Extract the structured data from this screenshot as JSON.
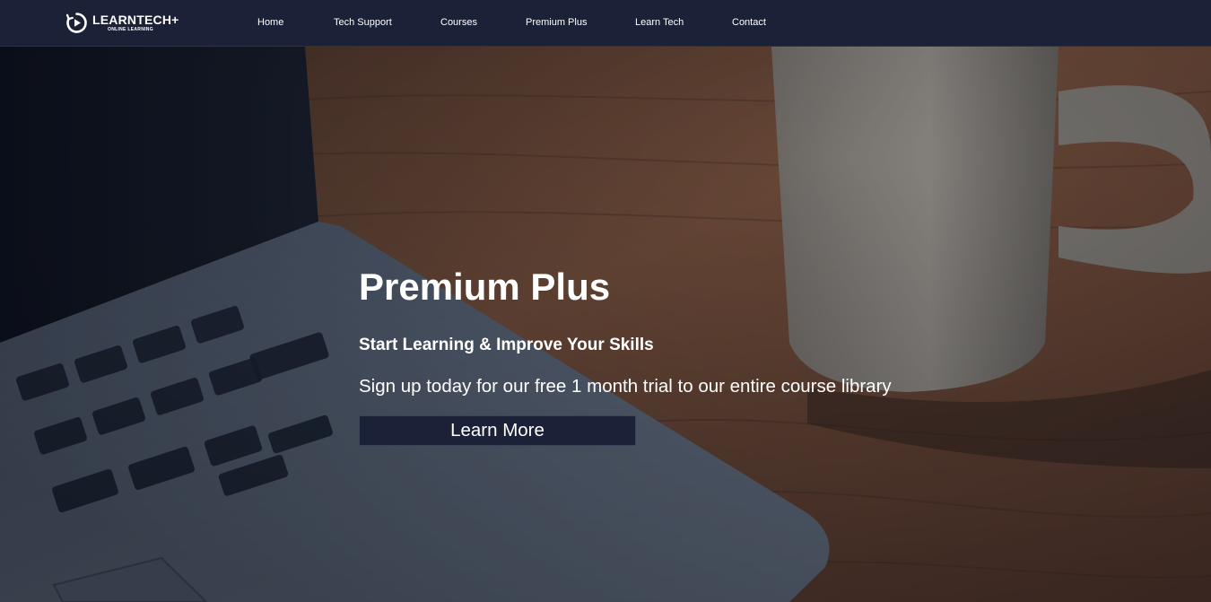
{
  "brand": {
    "name": "LEARNTECH+",
    "tagline": "ONLINE LEARNING",
    "logo_icon": "play-circle-icon"
  },
  "nav": {
    "items": [
      {
        "label": "Home"
      },
      {
        "label": "Tech Support"
      },
      {
        "label": "Courses"
      },
      {
        "label": "Premium Plus"
      },
      {
        "label": "Learn Tech"
      },
      {
        "label": "Contact"
      }
    ]
  },
  "hero": {
    "title": "Premium Plus",
    "subtitle": "Start Learning & Improve Your Skills",
    "text": "Sign up today for our free 1 month trial to our entire course library",
    "button_label": "Learn More"
  },
  "colors": {
    "navbar": "#1b2237",
    "button": "#1b2237",
    "text": "#ffffff"
  }
}
